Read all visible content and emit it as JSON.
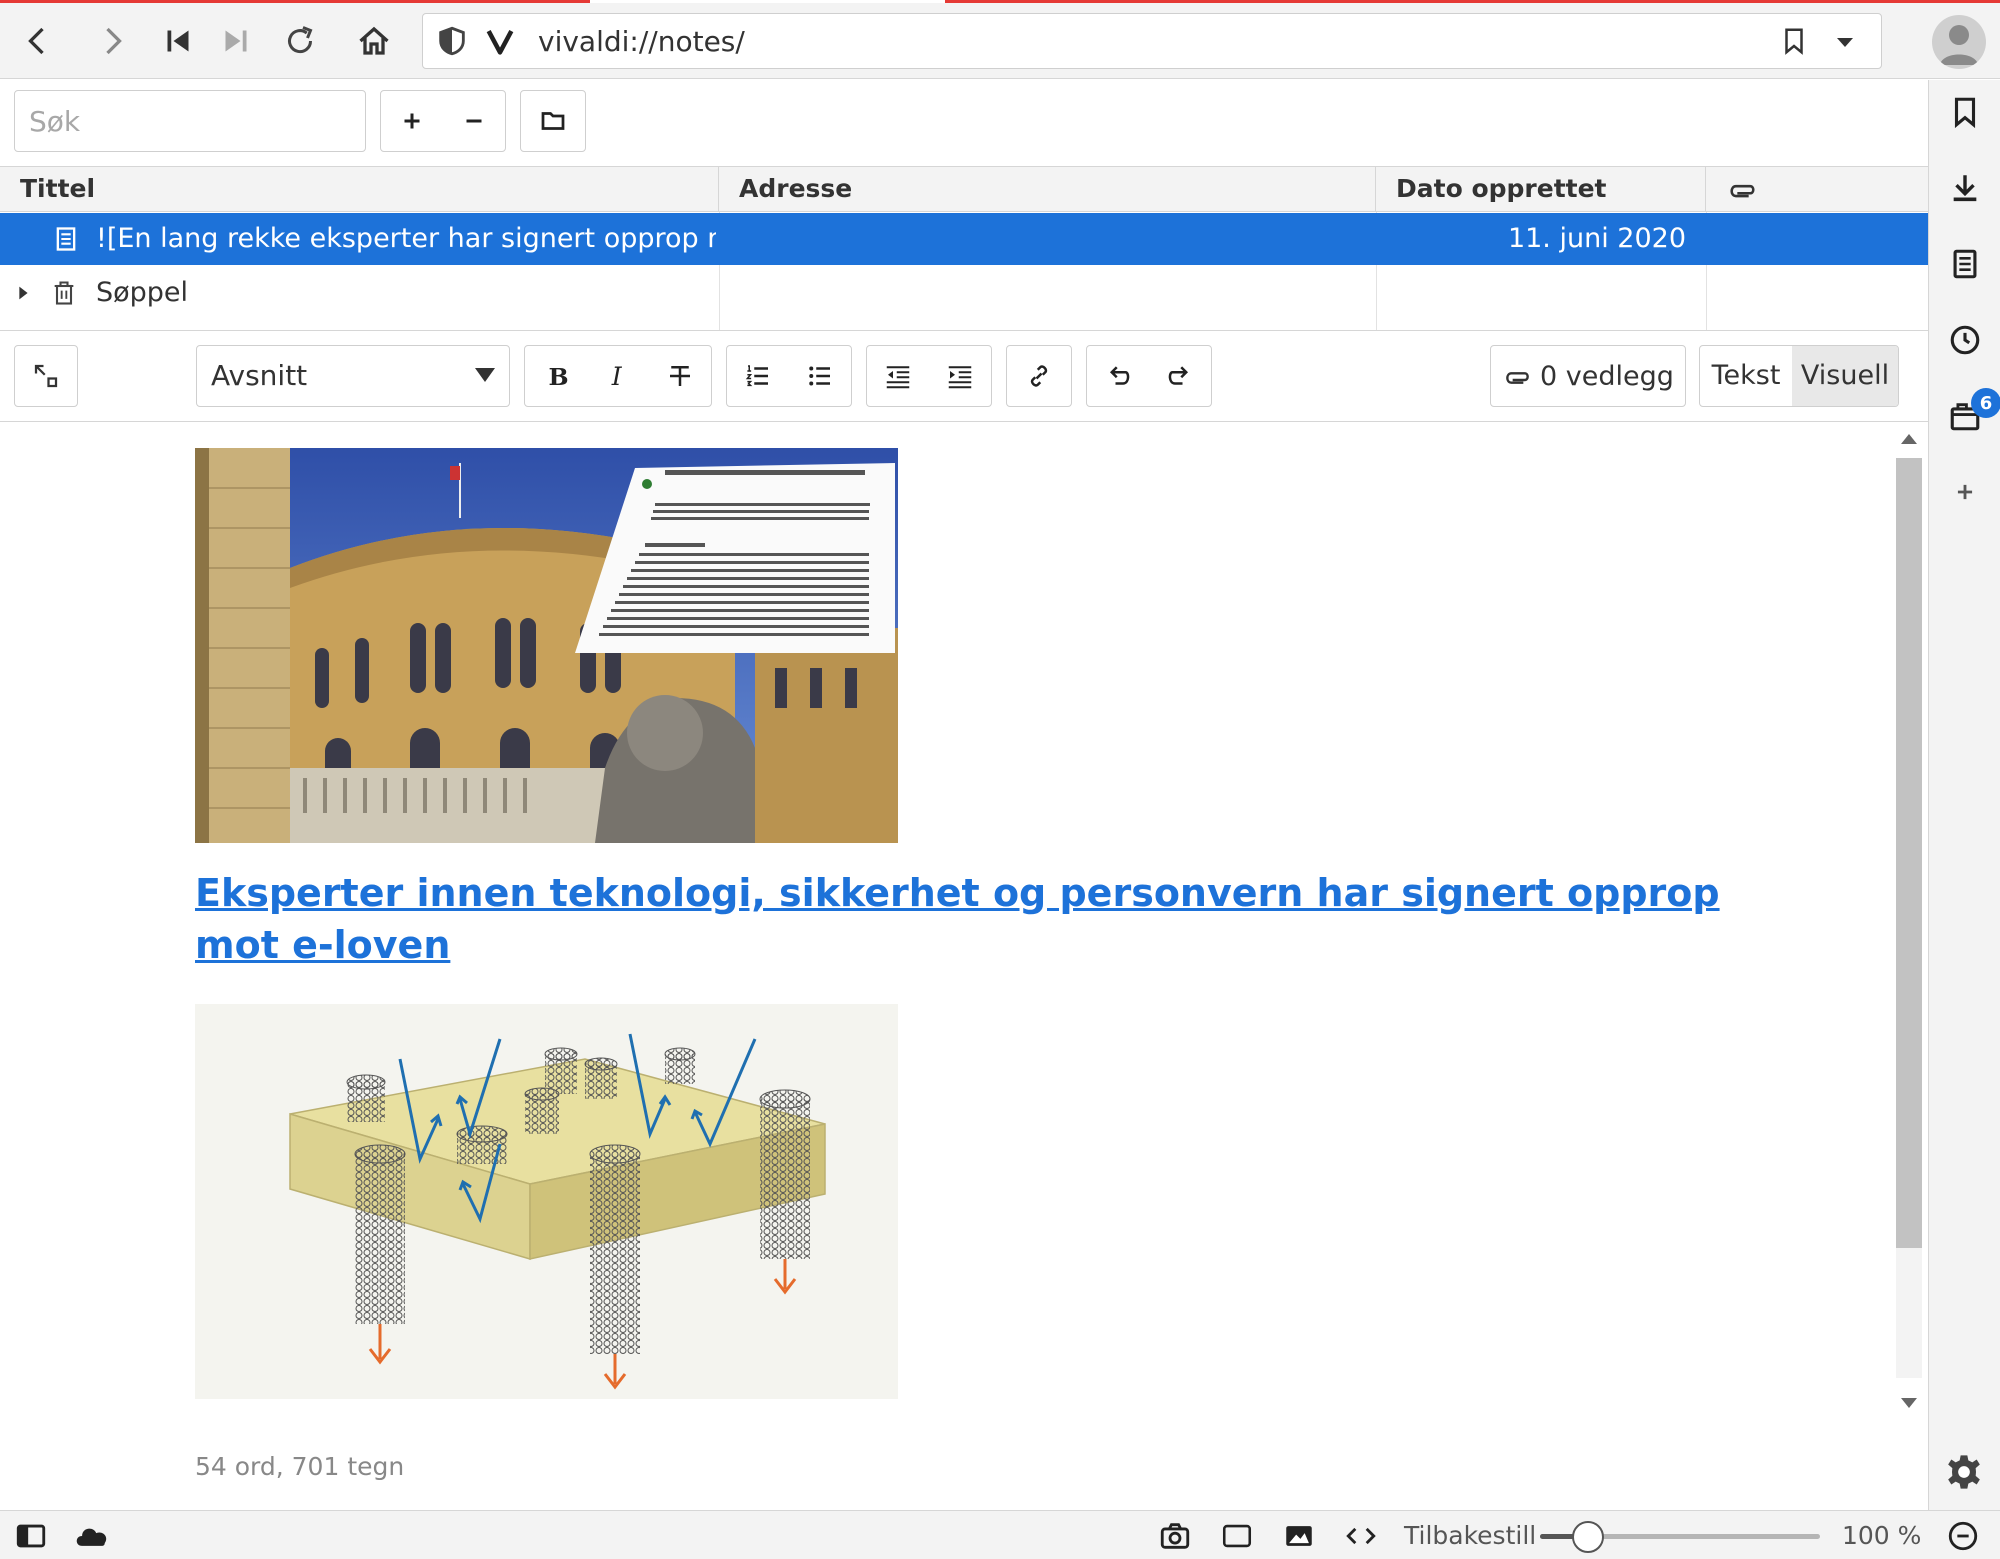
{
  "browser": {
    "url": "vivaldi://notes/",
    "tabs_badge_count": "6"
  },
  "notes": {
    "search_placeholder": "Søk",
    "columns": {
      "title": "Tittel",
      "address": "Adresse",
      "date_created": "Dato opprettet"
    },
    "rows": [
      {
        "title": "![En lang rekke eksperter har signert opprop m...",
        "address": "",
        "date": "11. juni 2020",
        "selected": true
      },
      {
        "title": "Søppel",
        "address": "",
        "date": "",
        "selected": false
      }
    ]
  },
  "editor": {
    "paragraph_style": "Avsnitt",
    "attachments_label": "0 vedlegg",
    "mode_text": "Tekst",
    "mode_visual": "Visuell",
    "active_mode": "Visuell",
    "headline": "Eksperter innen teknologi, sikkerhet og personvern har signert opprop mot e-loven",
    "word_count": "54 ord, 701 tegn"
  },
  "statusbar": {
    "reset_label": "Tilbakestill",
    "zoom_label": "100 %",
    "zoom_fraction": 0.17
  },
  "colors": {
    "accent": "#e53935",
    "selection": "#1d72d9",
    "link": "#1d72d9"
  }
}
